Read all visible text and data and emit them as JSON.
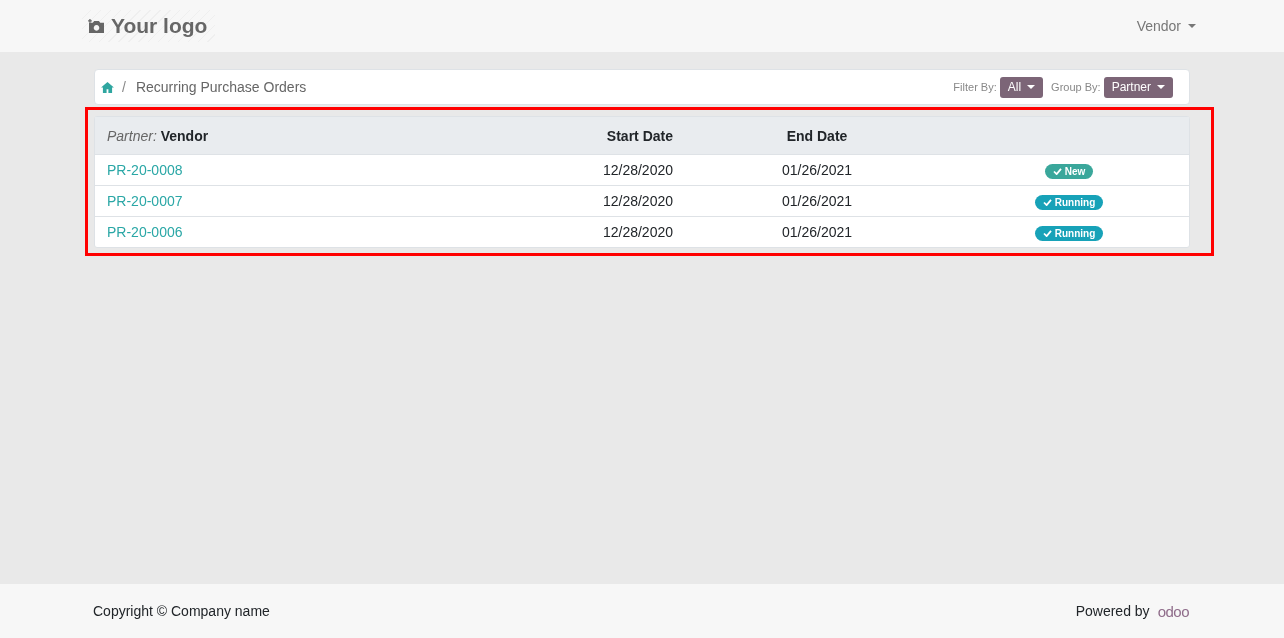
{
  "header": {
    "logo": "Your logo",
    "user_menu": "Vendor"
  },
  "breadcrumb": {
    "separator": "/",
    "current": "Recurring Purchase Orders"
  },
  "filters": [
    {
      "label": "Filter By:",
      "value": "All"
    },
    {
      "label": "Group By:",
      "value": "Partner"
    }
  ],
  "table": {
    "group_label": "Partner:",
    "group_value": "Vendor",
    "columns": [
      "Start Date",
      "End Date"
    ],
    "rows": [
      {
        "reference": "PR-20-0008",
        "start_date": "12/28/2020",
        "end_date": "01/26/2021",
        "status": "New",
        "color": "#3aa79b"
      },
      {
        "reference": "PR-20-0007",
        "start_date": "12/28/2020",
        "end_date": "01/26/2021",
        "status": "Running",
        "color": "#17a2b8"
      },
      {
        "reference": "PR-20-0006",
        "start_date": "12/28/2020",
        "end_date": "01/26/2021",
        "status": "Running",
        "color": "#17a2b8"
      }
    ]
  },
  "footer": {
    "copyright": "Copyright © Company name",
    "powered_by": "Powered by",
    "brand": "odoo"
  }
}
